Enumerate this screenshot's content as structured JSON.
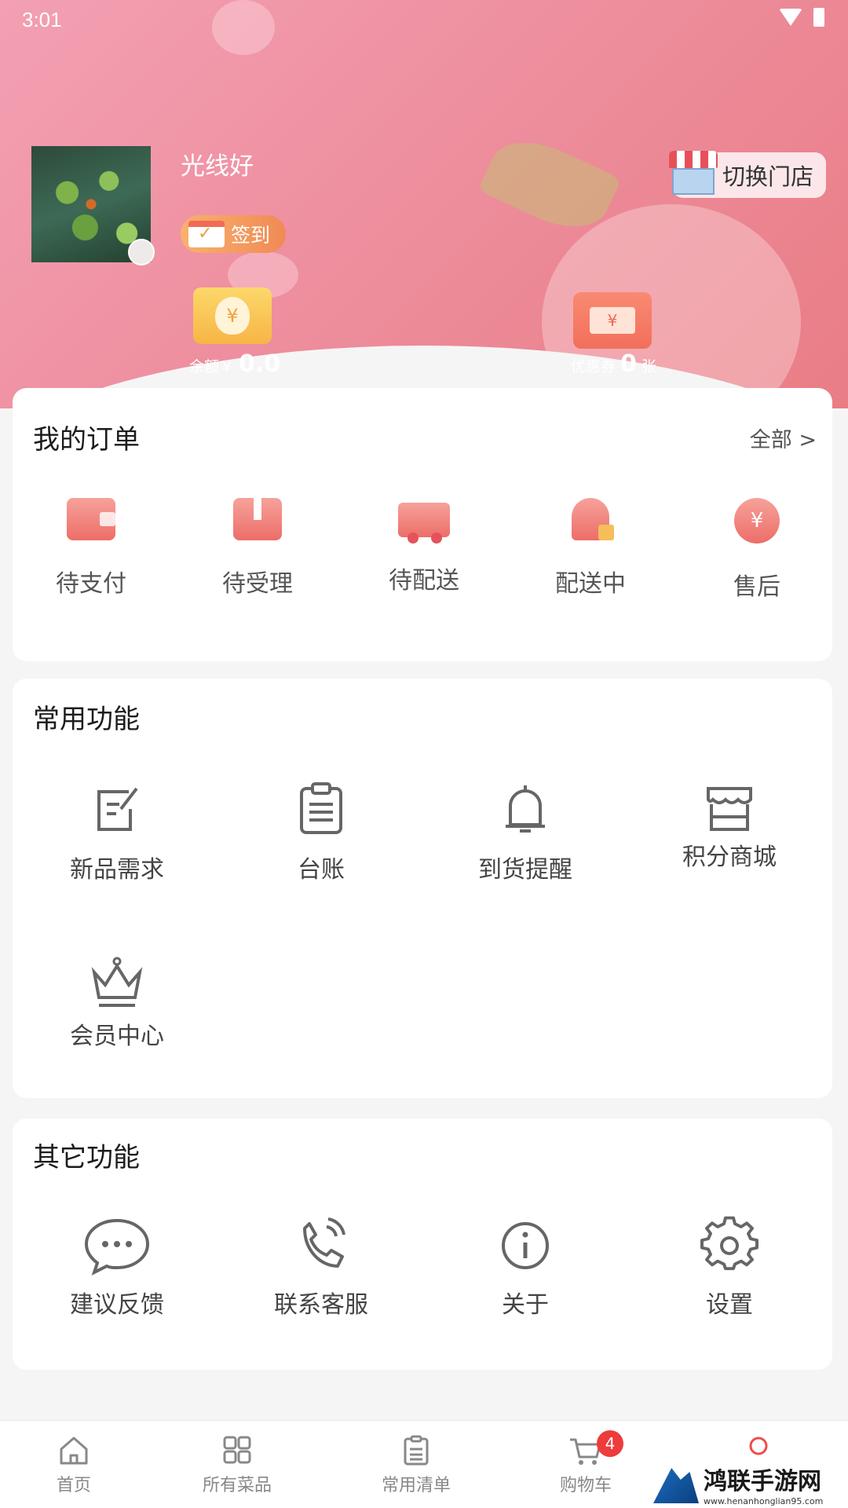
{
  "status_bar": {
    "time": "3:01"
  },
  "profile": {
    "username": "光线好",
    "signin_label": "签到",
    "switch_store_label": "切换门店"
  },
  "stats": {
    "balance_label": "余额￥",
    "balance_value": "0.0",
    "coupon_label": "优惠券",
    "coupon_value": "0",
    "coupon_unit": "张"
  },
  "orders": {
    "title": "我的订单",
    "view_all": "全部 >",
    "items": [
      {
        "label": "待支付",
        "icon": "wallet-icon"
      },
      {
        "label": "待受理",
        "icon": "box-icon"
      },
      {
        "label": "待配送",
        "icon": "truck-icon"
      },
      {
        "label": "配送中",
        "icon": "courier-icon"
      },
      {
        "label": "售后",
        "icon": "aftersale-yuan-icon",
        "glyph": "¥"
      }
    ]
  },
  "common_functions": {
    "title": "常用功能",
    "items": [
      {
        "label": "新品需求",
        "icon": "edit-note-icon"
      },
      {
        "label": "台账",
        "icon": "clipboard-icon"
      },
      {
        "label": "到货提醒",
        "icon": "bell-icon"
      },
      {
        "label": "积分商城",
        "icon": "store-icon"
      },
      {
        "label": "会员中心",
        "icon": "crown-icon"
      }
    ]
  },
  "other_functions": {
    "title": "其它功能",
    "items": [
      {
        "label": "建议反馈",
        "icon": "chat-bubble-icon"
      },
      {
        "label": "联系客服",
        "icon": "phone-icon"
      },
      {
        "label": "关于",
        "icon": "info-icon"
      },
      {
        "label": "设置",
        "icon": "gear-icon"
      }
    ]
  },
  "tabbar": {
    "items": [
      {
        "label": "首页",
        "icon": "home-icon"
      },
      {
        "label": "所有菜品",
        "icon": "grid-icon"
      },
      {
        "label": "常用清单",
        "icon": "list-icon"
      },
      {
        "label": "购物车",
        "icon": "cart-icon",
        "badge": "4"
      },
      {
        "label": "",
        "icon": "profile-icon"
      }
    ]
  },
  "watermark": {
    "title": "鸿联手游网",
    "url": "www.henanhonglian95.com"
  },
  "colors": {
    "header_pink": "#ee8f9f",
    "accent_red": "#ec6e68",
    "badge_red": "#ee3b3b"
  }
}
